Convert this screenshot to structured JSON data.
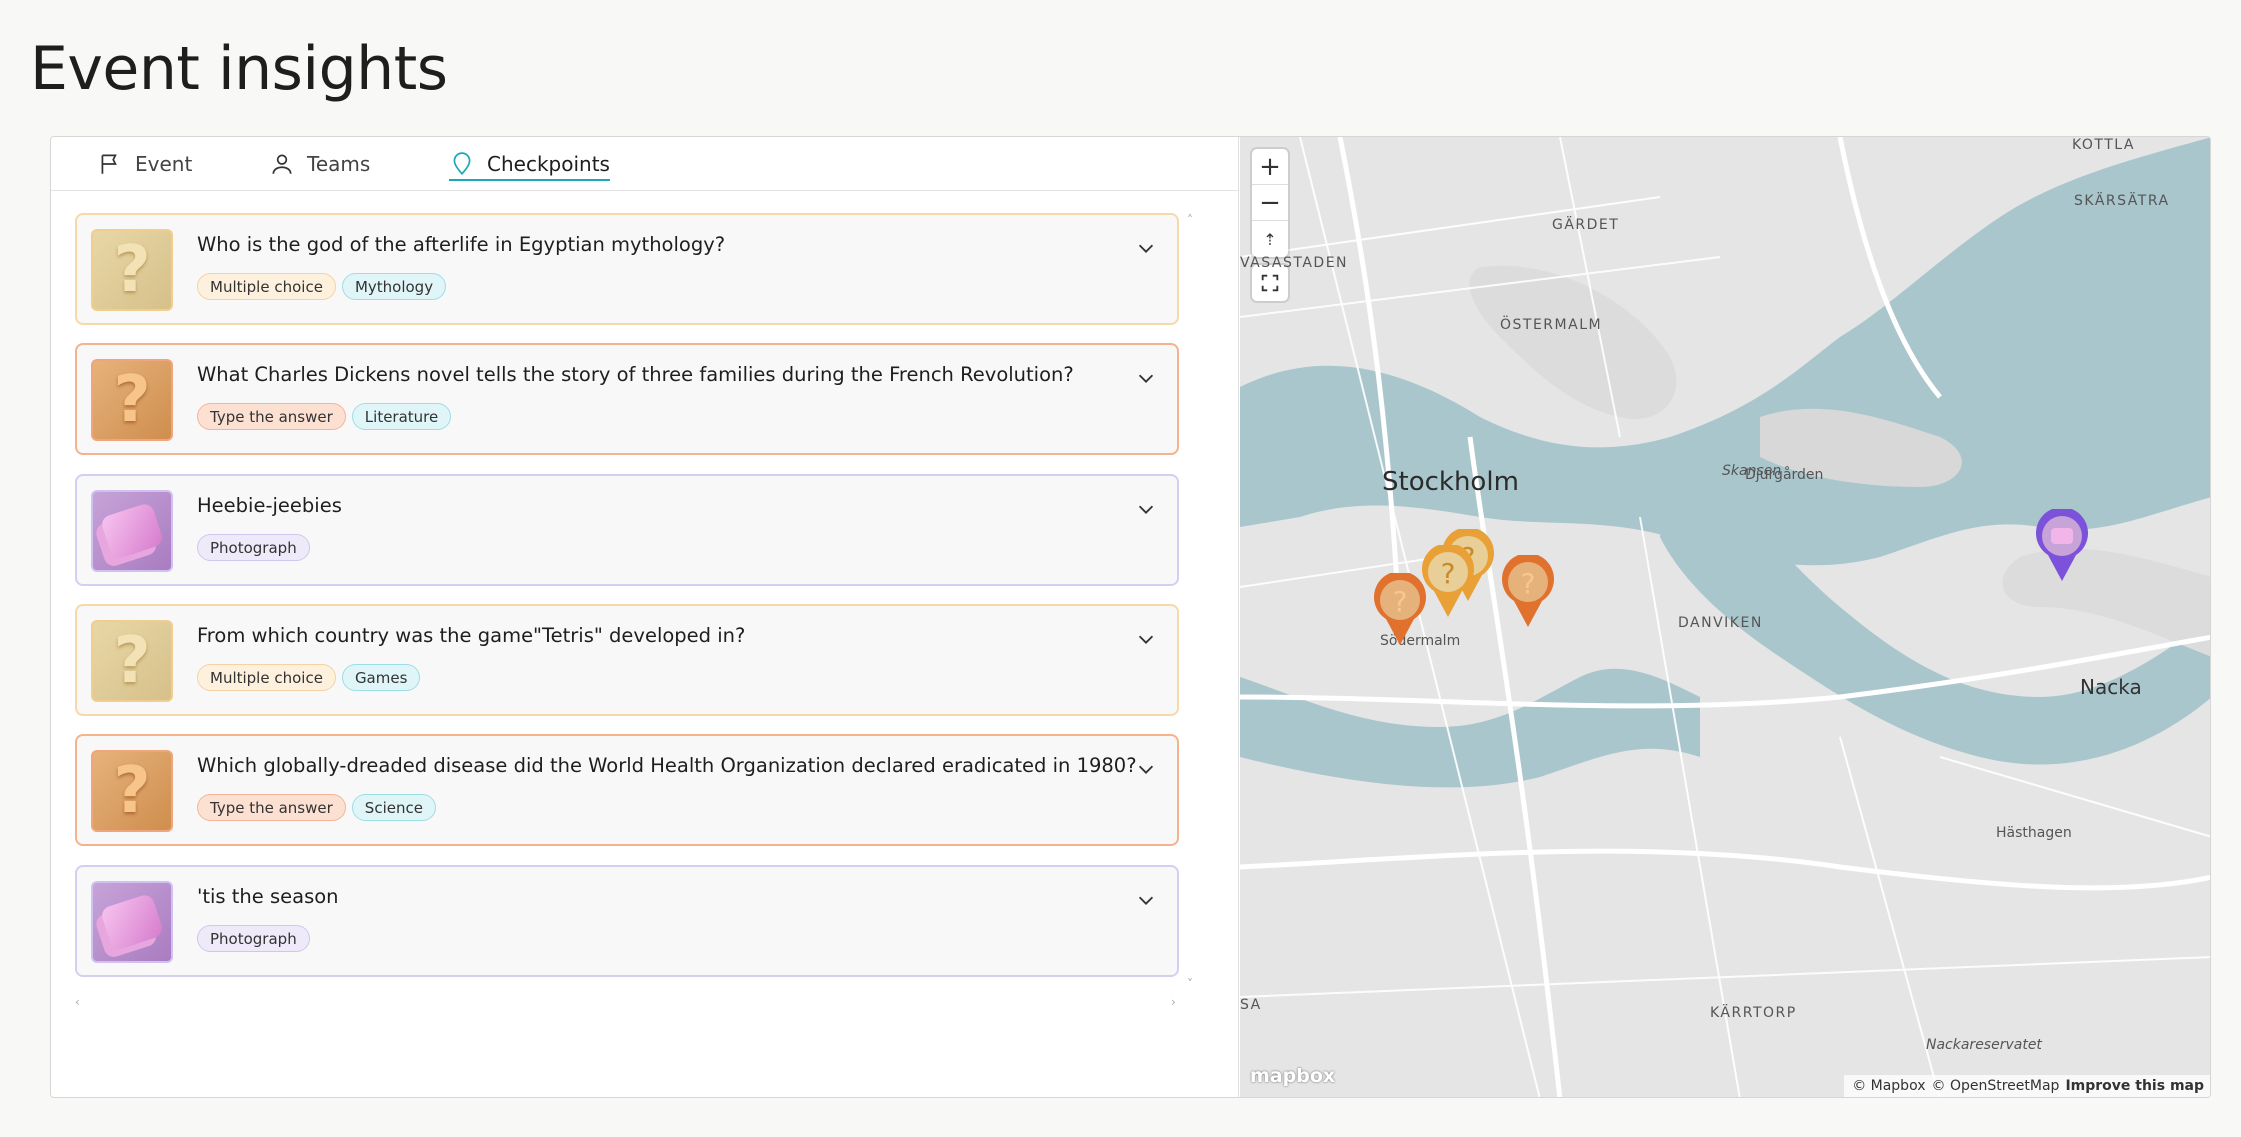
{
  "page": {
    "title": "Event insights"
  },
  "tabs": [
    {
      "label": "Event",
      "icon": "flag-icon"
    },
    {
      "label": "Teams",
      "icon": "person-icon"
    },
    {
      "label": "Checkpoints",
      "icon": "map-pin-icon",
      "active": true
    }
  ],
  "checkpoints": [
    {
      "question": "Who is the god of the afterlife in Egyptian mythology?",
      "type": "Multiple choice",
      "category": "Mythology",
      "style": "yellow"
    },
    {
      "question": "What Charles Dickens novel tells the story of three families during the French Revolution?",
      "type": "Type the answer",
      "category": "Literature",
      "style": "orange"
    },
    {
      "question": "Heebie-jeebies",
      "type": "Photograph",
      "category": "",
      "style": "purple"
    },
    {
      "question": "From which country was the game\"Tetris\" developed in?",
      "type": "Multiple choice",
      "category": "Games",
      "style": "yellow"
    },
    {
      "question": "Which globally-dreaded disease did the World Health Organization declared eradicated in 1980?",
      "type": "Type the answer",
      "category": "Science",
      "style": "orange"
    },
    {
      "question": "'tis the season",
      "type": "Photograph",
      "category": "",
      "style": "purple"
    }
  ],
  "map": {
    "zoom_in": "+",
    "zoom_out": "−",
    "labels": {
      "kottla": "KOTTLA",
      "skarsatra": "SKÄRSÄTRA",
      "gardet": "GÄRDET",
      "vasastaden": "VASASTADEN",
      "ostermalm": "ÖSTERMALM",
      "stockholm": "Stockholm",
      "skansen": "Skansen",
      "djurgarden": "Djurgården",
      "danviken": "DANVIKEN",
      "sodermalm": "Södermalm",
      "nacka": "Nacka",
      "hasthagen": "Hästhagen",
      "karrtorp": "KÄRRTORP",
      "nackareservatet": "Nackareservatet",
      "sa": "SA"
    },
    "logo": "mapbox",
    "attribution_1": "© Mapbox",
    "attribution_2": "© OpenStreetMap",
    "improve": "Improve this map"
  }
}
